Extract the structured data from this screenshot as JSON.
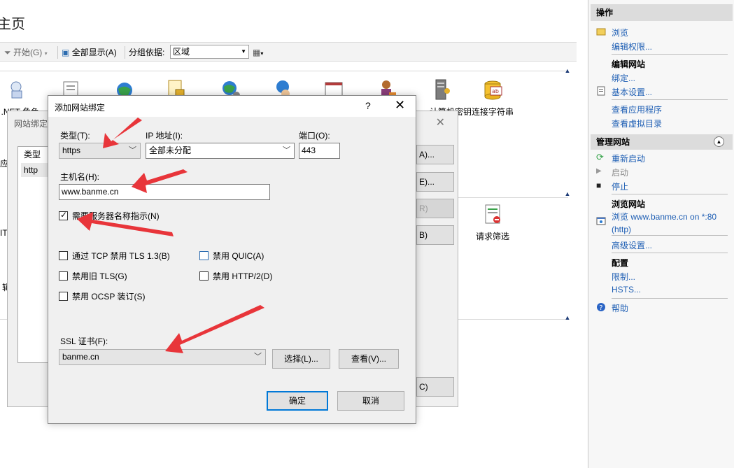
{
  "main": {
    "title": "主页",
    "title_visible": "主页",
    "toolbar": {
      "start_label": "开始(G)",
      "show_all_label": "全部显示(A)",
      "group_by_label": "分组依据:",
      "group_by_value": "区域"
    },
    "features": {
      "net_role_label": ".NET 角色",
      "computer_key_label": "计算机密钥",
      "connection_strings_label": "连接字符串",
      "request_filtering_label": "请求筛选"
    }
  },
  "bg_dialog": {
    "title": "网站绑定",
    "list_header_type": "类型",
    "list_row_type": "http",
    "buttons": [
      "A)...",
      "E)...",
      "R)",
      "B)",
      "C)"
    ]
  },
  "dialog": {
    "title": "添加网站绑定",
    "help": "?",
    "close": "✕",
    "type_label": "类型(T):",
    "type_value": "https",
    "ip_label": "IP 地址(I):",
    "ip_value": "全部未分配",
    "port_label": "端口(O):",
    "port_value": "443",
    "host_label": "主机名(H):",
    "host_value": "www.banme.cn",
    "sni_label": "需要服务器名称指示(N)",
    "sni_checked": true,
    "disable_tls13_label": "通过 TCP 禁用 TLS 1.3(B)",
    "disable_quic_label": "禁用 QUIC(A)",
    "disable_legacy_tls_label": "禁用旧 TLS(G)",
    "disable_http2_label": "禁用 HTTP/2(D)",
    "disable_ocsp_label": "禁用 OCSP 装订(S)",
    "ssl_label": "SSL 证书(F):",
    "ssl_value": "banme.cn",
    "select_button": "选择(L)...",
    "view_button": "查看(V)...",
    "ok_button": "确定",
    "cancel_button": "取消"
  },
  "actions": {
    "header": "操作",
    "browse": "浏览",
    "edit_permissions": "编辑权限...",
    "edit_site_header": "编辑网站",
    "bindings": "绑定...",
    "basic_settings": "基本设置...",
    "view_apps": "查看应用程序",
    "view_vdirs": "查看虚拟目录",
    "manage_site_header": "管理网站",
    "restart": "重新启动",
    "start": "启动",
    "stop": "停止",
    "browse_site_header": "浏览网站",
    "browse_link_line1": "浏览 www.banme.cn on *:80",
    "browse_link_line2": "(http)",
    "advanced_settings": "高级设置...",
    "config_header": "配置",
    "limits": "限制...",
    "hsts": "HSTS...",
    "help": "帮助"
  },
  "colors": {
    "link": "#1f5fb4",
    "arrow": "#e8353a",
    "primary_border": "#0078d7"
  }
}
